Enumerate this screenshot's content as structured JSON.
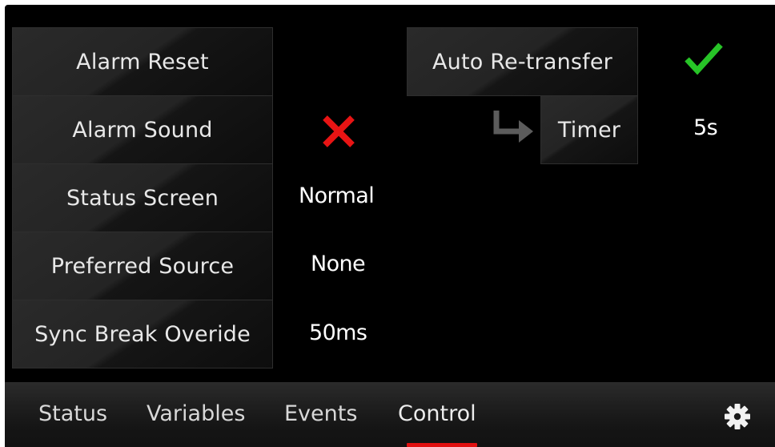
{
  "settings": {
    "alarm_reset": {
      "label": "Alarm Reset"
    },
    "alarm_sound": {
      "label": "Alarm Sound",
      "state": "off"
    },
    "status_screen": {
      "label": "Status Screen",
      "value": "Normal"
    },
    "preferred_source": {
      "label": "Preferred Source",
      "value": "None"
    },
    "sync_break": {
      "label": "Sync Break Overide",
      "value": "50ms"
    },
    "auto_retransfer": {
      "label": "Auto Re-transfer",
      "state": "on"
    },
    "timer": {
      "label": "Timer",
      "value": "5s"
    }
  },
  "icons": {
    "enabled": "check-icon",
    "disabled": "x-icon",
    "sub_setting": "sub-arrow-icon",
    "settings": "gear-icon"
  },
  "colors": {
    "check": "#27c427",
    "cross": "#e81414",
    "active_tab_underline": "#e01010"
  },
  "nav": {
    "tabs": [
      {
        "label": "Status"
      },
      {
        "label": "Variables"
      },
      {
        "label": "Events"
      },
      {
        "label": "Control"
      }
    ],
    "active_tab": "Control"
  }
}
